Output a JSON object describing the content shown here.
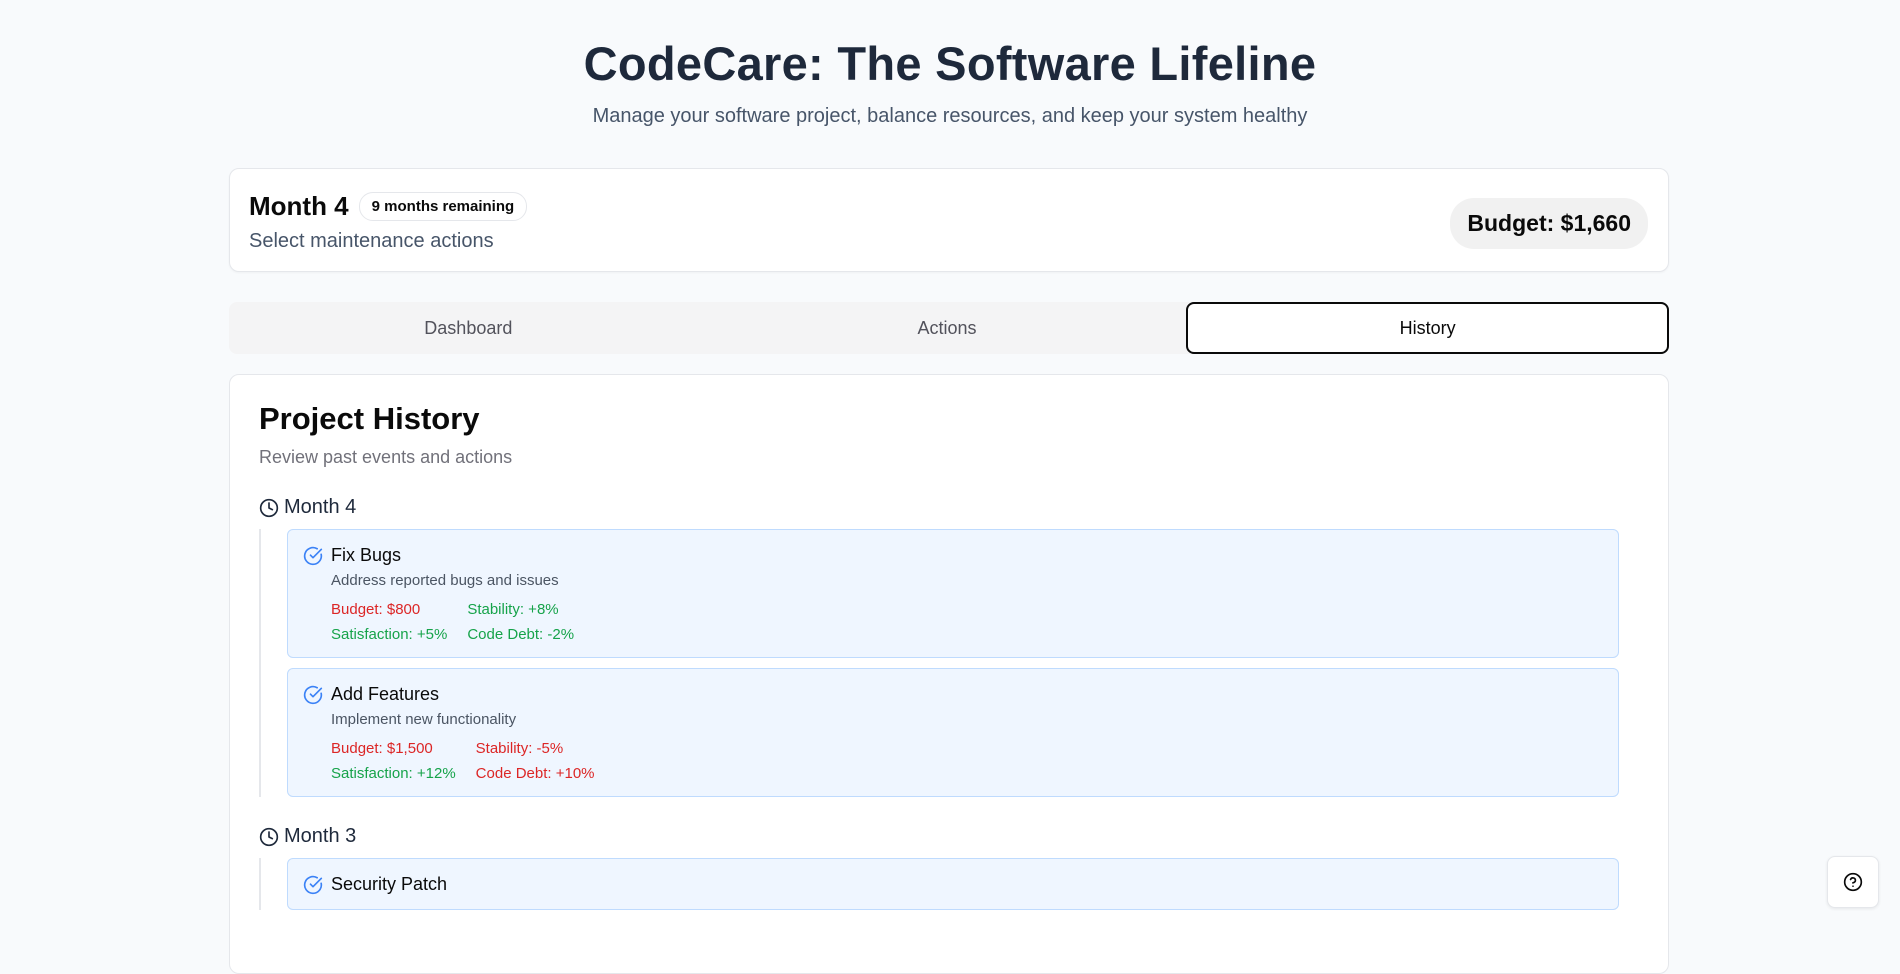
{
  "header": {
    "title": "CodeCare: The Software Lifeline",
    "subtitle": "Manage your software project, balance resources, and keep your system healthy"
  },
  "status": {
    "month": "Month 4",
    "remaining": "9 months remaining",
    "subtitle": "Select maintenance actions",
    "budget": "Budget: $1,660"
  },
  "tabs": [
    {
      "label": "Dashboard",
      "active": false
    },
    {
      "label": "Actions",
      "active": false
    },
    {
      "label": "History",
      "active": true
    }
  ],
  "history": {
    "title": "Project History",
    "subtitle": "Review past events and actions",
    "months": [
      {
        "label": "Month 4",
        "entries": [
          {
            "title": "Fix Bugs",
            "description": "Address reported bugs and issues",
            "effects": [
              {
                "text": "Budget: $800",
                "tone": "neg"
              },
              {
                "text": "Stability: +8%",
                "tone": "pos"
              },
              {
                "text": "Satisfaction: +5%",
                "tone": "pos"
              },
              {
                "text": "Code Debt: -2%",
                "tone": "pos"
              }
            ]
          },
          {
            "title": "Add Features",
            "description": "Implement new functionality",
            "effects": [
              {
                "text": "Budget: $1,500",
                "tone": "neg"
              },
              {
                "text": "Stability: -5%",
                "tone": "neg"
              },
              {
                "text": "Satisfaction: +12%",
                "tone": "pos"
              },
              {
                "text": "Code Debt: +10%",
                "tone": "neg"
              }
            ]
          }
        ]
      },
      {
        "label": "Month 3",
        "entries": [
          {
            "title": "Security Patch",
            "description": "",
            "effects": []
          }
        ]
      }
    ]
  },
  "icons": {
    "clock": "clock-icon",
    "check": "check-circle-icon",
    "help": "help-icon"
  },
  "colors": {
    "accent": "#3b82f6",
    "negative": "#dc2626",
    "positive": "#16a34a",
    "entry_bg": "#eff6ff"
  }
}
